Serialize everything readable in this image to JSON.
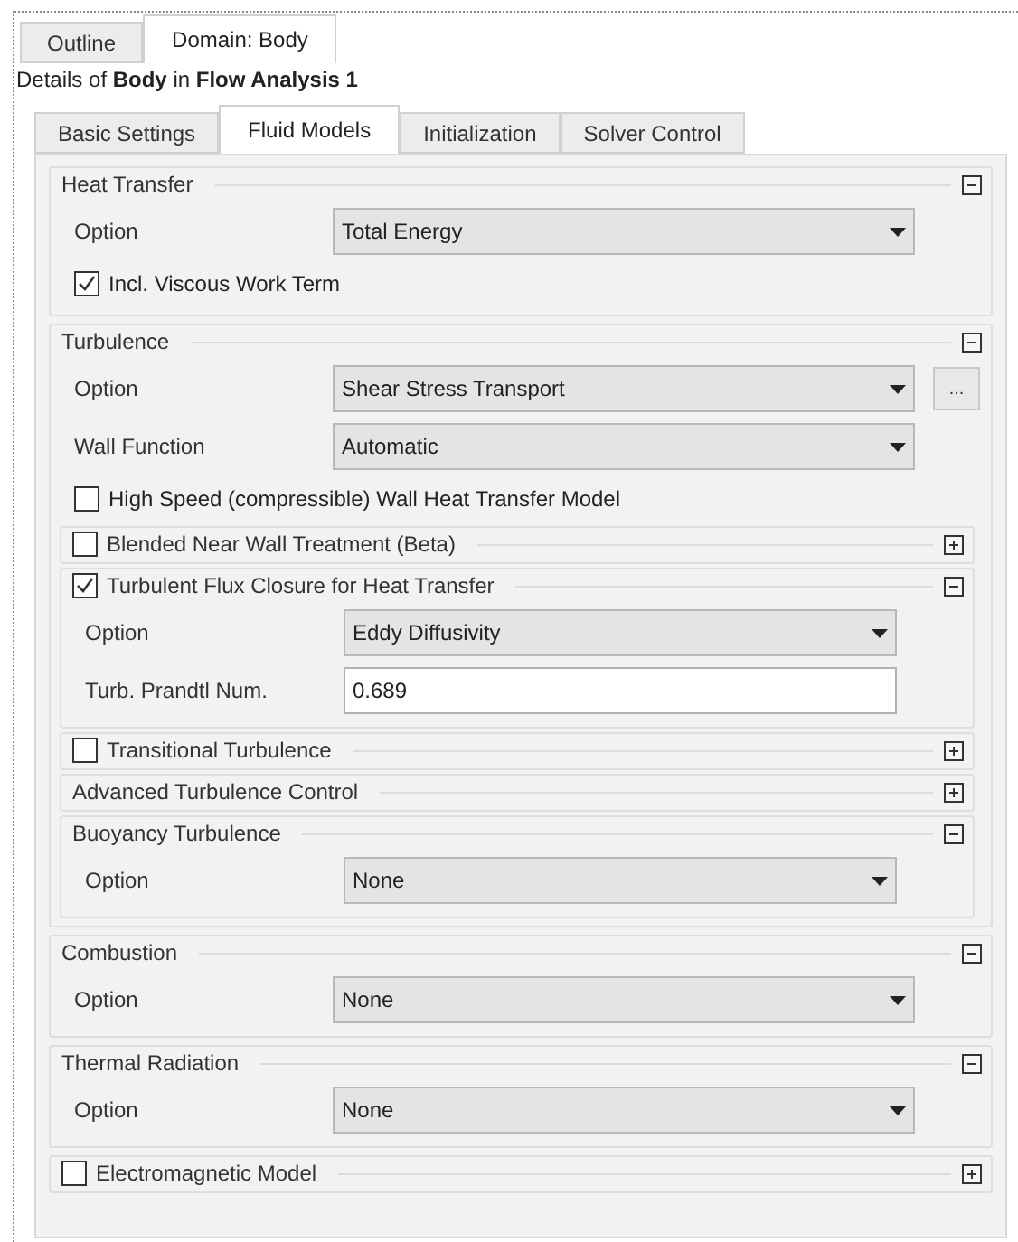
{
  "top_tabs": [
    {
      "label": "Outline",
      "selected": false
    },
    {
      "label": "Domain: Body",
      "selected": true
    }
  ],
  "details": "Details of **Body** in **Flow Analysis 1**",
  "tabs": [
    {
      "label": "Basic Settings",
      "selected": false
    },
    {
      "label": "Fluid Models",
      "selected": true
    },
    {
      "label": "Initialization",
      "selected": false
    },
    {
      "label": "Solver Control",
      "selected": false
    }
  ],
  "sections": [
    {
      "kind": "group",
      "title": "Heat Transfer",
      "expanded": true,
      "children": [
        {
          "kind": "select",
          "label": "Option",
          "value": "Total Energy"
        },
        {
          "kind": "checkbox",
          "label": "Incl. Viscous Work Term",
          "checked": true
        }
      ]
    },
    {
      "kind": "group",
      "title": "Turbulence",
      "expanded": true,
      "children": [
        {
          "kind": "select",
          "label": "Option",
          "value": "Shear Stress Transport",
          "more": "..."
        },
        {
          "kind": "select",
          "label": "Wall Function",
          "value": "Automatic"
        },
        {
          "kind": "checkbox",
          "label": "High Speed (compressible) Wall Heat Transfer Model",
          "checked": false
        },
        {
          "kind": "group",
          "title": "Blended Near Wall Treatment (Beta)",
          "checked": false,
          "expanded": false
        },
        {
          "kind": "group",
          "title": "Turbulent Flux Closure for Heat Transfer",
          "checked": true,
          "expanded": true,
          "children": [
            {
              "kind": "select",
              "label": "Option",
              "value": "Eddy Diffusivity"
            },
            {
              "kind": "text_field",
              "label": "Turb. Prandtl Num.",
              "value": "0.689"
            }
          ]
        },
        {
          "kind": "group",
          "title": "Transitional Turbulence",
          "checked": false,
          "expanded": false
        },
        {
          "kind": "group",
          "title": "Advanced Turbulence Control",
          "expanded": false
        },
        {
          "kind": "group",
          "title": "Buoyancy Turbulence",
          "expanded": true,
          "children": [
            {
              "kind": "select",
              "label": "Option",
              "value": "None"
            }
          ]
        }
      ]
    },
    {
      "kind": "group",
      "title": "Combustion",
      "expanded": true,
      "children": [
        {
          "kind": "select",
          "label": "Option",
          "value": "None"
        }
      ]
    },
    {
      "kind": "group",
      "title": "Thermal Radiation",
      "expanded": true,
      "children": [
        {
          "kind": "select",
          "label": "Option",
          "value": "None"
        }
      ]
    },
    {
      "kind": "group",
      "title": "Electromagnetic Model",
      "checked": false,
      "expanded": false
    }
  ]
}
